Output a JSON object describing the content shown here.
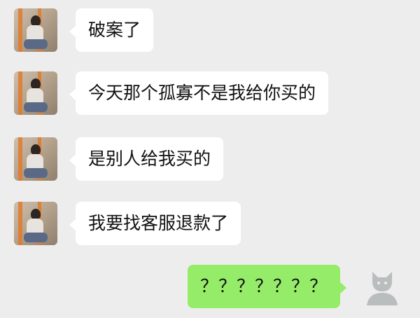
{
  "chat": {
    "messages": [
      {
        "side": "left",
        "text": "破案了"
      },
      {
        "side": "left",
        "text": "今天那个孤寡不是我给你买的"
      },
      {
        "side": "left",
        "text": "是别人给我买的"
      },
      {
        "side": "left",
        "text": "我要找客服退款了"
      },
      {
        "side": "right",
        "text": "？？？？？？？"
      }
    ]
  },
  "colors": {
    "background": "#ededed",
    "incoming_bubble": "#ffffff",
    "outgoing_bubble": "#95ec69"
  },
  "icons": {
    "friend_avatar": "photo-avatar",
    "my_avatar": "default-user-avatar-icon"
  }
}
